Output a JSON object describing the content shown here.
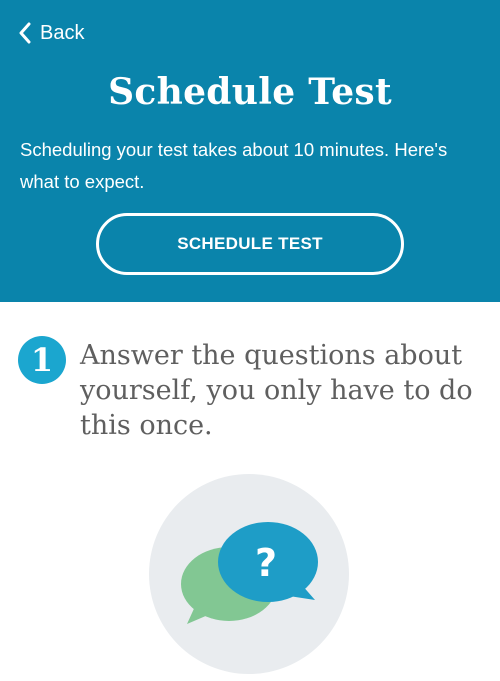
{
  "header": {
    "back_label": "Back",
    "title": "Schedule Test",
    "description": "Scheduling your test takes about 10 minutes. Here's what to expect.",
    "cta_label": "SCHEDULE TEST"
  },
  "step": {
    "number": "1",
    "text": "Answer the questions about yourself, you only have to do this once."
  },
  "illustration": {
    "bubble_symbol": "?"
  },
  "colors": {
    "header_bg": "#0a84ab",
    "accent": "#1ba6cf",
    "bubble_green": "#82c793",
    "bubble_blue": "#1e9dc7",
    "circle_bg": "#e9ecef"
  }
}
